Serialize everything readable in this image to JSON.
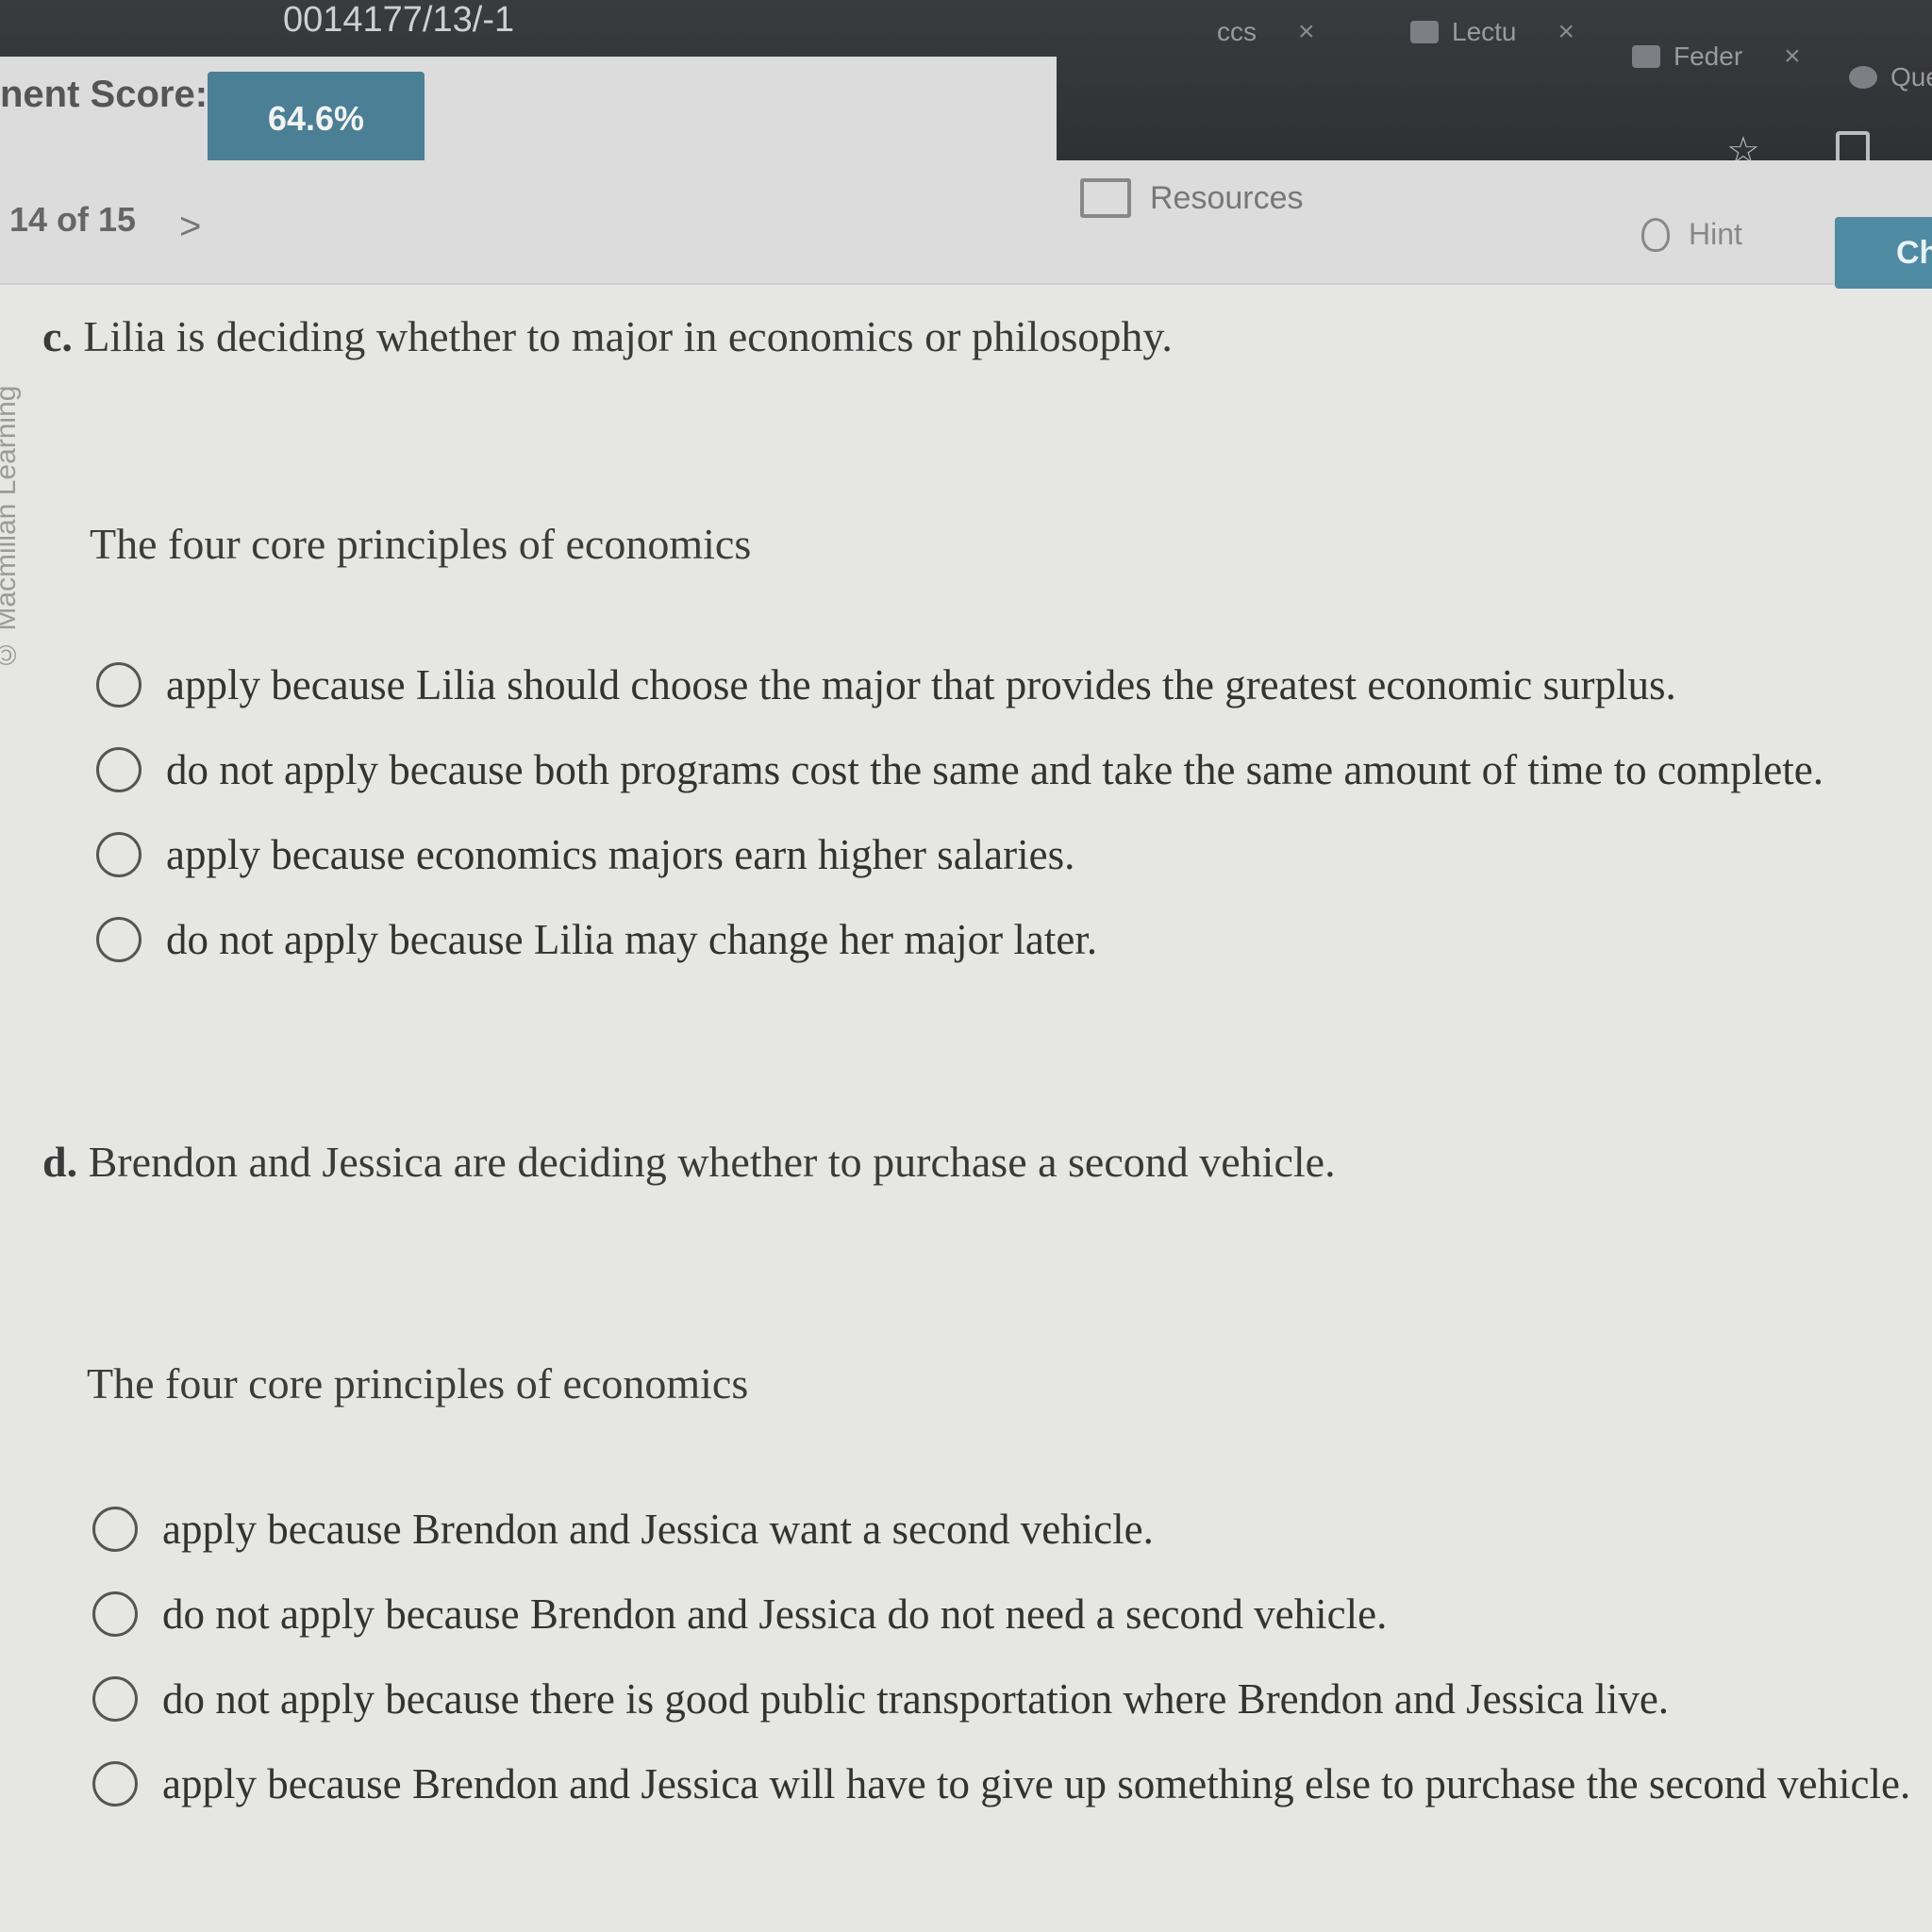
{
  "browser": {
    "url_fragment": "0014177/13/-1",
    "tabs": [
      {
        "label": "ccs"
      },
      {
        "label": "Lectu"
      },
      {
        "label": "Feder"
      },
      {
        "label": "Que"
      }
    ]
  },
  "header": {
    "score_label": "nent Score:",
    "score_value": "64.6%"
  },
  "toolbar": {
    "position": "14 of 15",
    "next_icon": ">",
    "resources_label": "Resources",
    "hint_label": "Hint",
    "check_label": "Ch"
  },
  "sidebar": {
    "copyright": "© Macmillan Learning"
  },
  "questions": [
    {
      "letter": "c.",
      "text": "Lilia is deciding whether to major in economics or philosophy.",
      "prompt": "The four core principles of economics",
      "options": [
        "apply because Lilia should choose the major that provides the greatest economic surplus.",
        "do not apply because both programs cost the same and take the same amount of time to complete.",
        "apply because economics majors earn higher salaries.",
        "do not apply because Lilia may change her major later."
      ]
    },
    {
      "letter": "d.",
      "text": "Brendon and Jessica are deciding whether to purchase a second vehicle.",
      "prompt": "The four core principles of economics",
      "options": [
        "apply because Brendon and Jessica want a second vehicle.",
        "do not apply because Brendon and Jessica do not need a second vehicle.",
        "do not apply because there is good public transportation where Brendon and Jessica live.",
        "apply because Brendon and Jessica will have to give up something else to purchase the second vehicle."
      ]
    }
  ],
  "colors": {
    "score_badge": "#4a7f96",
    "check_button": "#4f8aa3",
    "page_background": "#e6e6e4"
  }
}
